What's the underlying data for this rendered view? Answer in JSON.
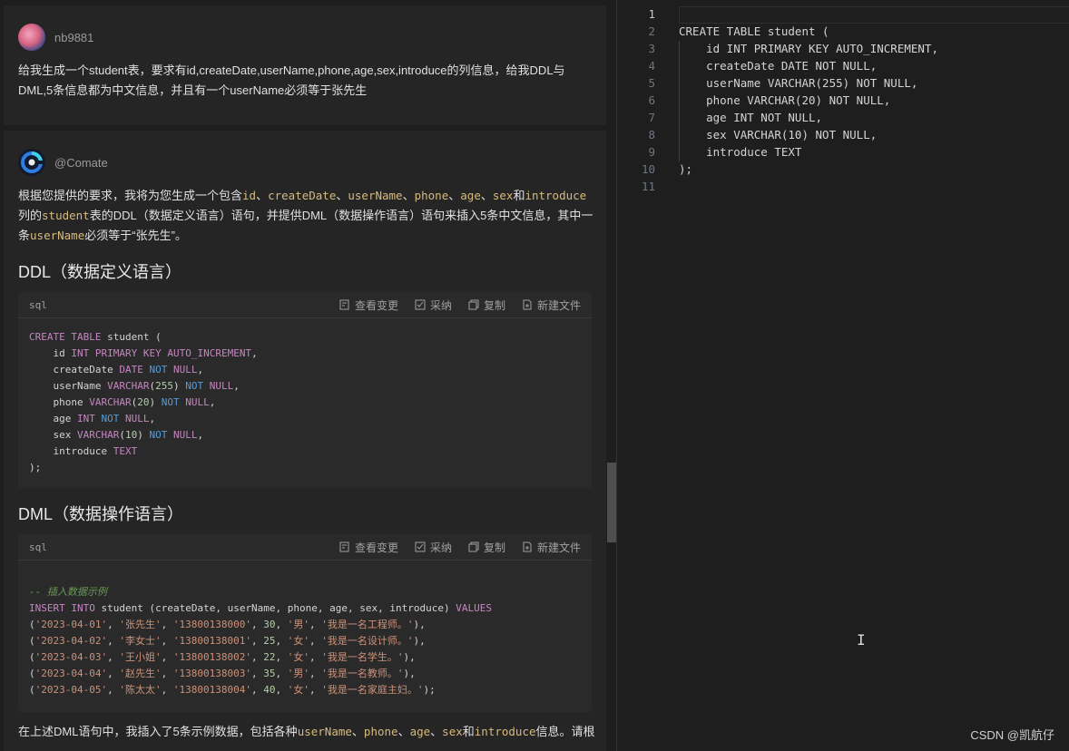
{
  "user_message": {
    "author": "nb9881",
    "text": "给我生成一个student表，要求有id,createDate,userName,phone,age,sex,introduce的列信息，给我DDL与DML,5条信息都为中文信息，并且有一个userName必须等于张先生"
  },
  "bot_message": {
    "author": "@Comate",
    "intro": {
      "p1": "根据您提供的要求，我将为您生成一个包含",
      "c_id": "id",
      "sep": "、",
      "c_createDate": "createDate",
      "c_userName": "userName",
      "c_phone": "phone",
      "c_age": "age",
      "c_sex": "sex",
      "and": "和",
      "c_introduce": "introduce",
      "p2": "列的",
      "c_student": "student",
      "p3": "表的DDL（数据定义语言）语句，并提供DML（数据操作语言）语句来插入5条中文信息，其中一条",
      "p4": "必须等于“张先生”。"
    },
    "ddl_heading": "DDL（数据定义语言）",
    "dml_heading": "DML（数据操作语言）",
    "code_actions": {
      "lang": "sql",
      "view_changes": "查看变更",
      "adopt": "采纳",
      "copy": "复制",
      "new_file": "新建文件"
    },
    "dml_comment": "-- 插入数据示例",
    "dml_insert": "INSERT INTO student (createDate, userName, phone, age, sex, introduce) VALUES",
    "rows": [
      {
        "date": "'2023-04-01'",
        "name": "'张先生'",
        "phone": "'13800138000'",
        "age": "30",
        "sex": "'男'",
        "intro": "'我是一名工程师。'",
        "end": "),"
      },
      {
        "date": "'2023-04-02'",
        "name": "'李女士'",
        "phone": "'13800138001'",
        "age": "25",
        "sex": "'女'",
        "intro": "'我是一名设计师。'",
        "end": "),"
      },
      {
        "date": "'2023-04-03'",
        "name": "'王小姐'",
        "phone": "'13800138002'",
        "age": "22",
        "sex": "'女'",
        "intro": "'我是一名学生。'",
        "end": "),"
      },
      {
        "date": "'2023-04-04'",
        "name": "'赵先生'",
        "phone": "'13800138003'",
        "age": "35",
        "sex": "'男'",
        "intro": "'我是一名教师。'",
        "end": "),"
      },
      {
        "date": "'2023-04-05'",
        "name": "'陈太太'",
        "phone": "'13800138004'",
        "age": "40",
        "sex": "'女'",
        "intro": "'我是一名家庭主妇。'",
        "end": ");"
      }
    ],
    "footer": {
      "p1": "在上述DML语句中，我插入了5条示例数据，包括各种",
      "c_userName": "userName",
      "sep": "、",
      "c_phone": "phone",
      "c_age": "age",
      "c_sex": "sex",
      "and": "和",
      "c_introduce": "introduce",
      "p2": "信息。请根"
    }
  },
  "ddl_lines": [
    "CREATE TABLE student (",
    "    id INT PRIMARY KEY AUTO_INCREMENT,",
    "    createDate DATE NOT NULL,",
    "    userName VARCHAR(255) NOT NULL,",
    "    phone VARCHAR(20) NOT NULL,",
    "    age INT NOT NULL,",
    "    sex VARCHAR(10) NOT NULL,",
    "    introduce TEXT",
    ");"
  ],
  "editor": {
    "line_numbers": [
      "1",
      "2",
      "3",
      "4",
      "5",
      "6",
      "7",
      "8",
      "9",
      "10",
      "11"
    ],
    "lines": [
      "",
      "CREATE TABLE student (",
      "    id INT PRIMARY KEY AUTO_INCREMENT,",
      "    createDate DATE NOT NULL,",
      "    userName VARCHAR(255) NOT NULL,",
      "    phone VARCHAR(20) NOT NULL,",
      "    age INT NOT NULL,",
      "    sex VARCHAR(10) NOT NULL,",
      "    introduce TEXT",
      ");",
      ""
    ]
  },
  "watermark": "CSDN @凯航仔",
  "colors": {
    "background": "#1e1e1e",
    "card": "#252526",
    "keyword": "#c586c0",
    "blue_keyword": "#569cd6",
    "string": "#ce9178",
    "number": "#b5cea8",
    "comment": "#6a9955",
    "inline_code": "#d7ba7d"
  }
}
